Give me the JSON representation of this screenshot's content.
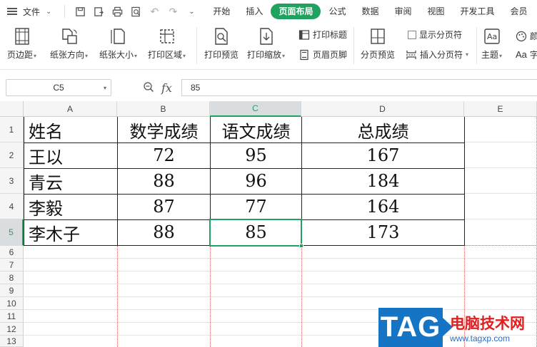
{
  "menubar": {
    "file_label": "文件",
    "tabs": [
      {
        "label": "开始",
        "active": false
      },
      {
        "label": "插入",
        "active": false
      },
      {
        "label": "页面布局",
        "active": true
      },
      {
        "label": "公式",
        "active": false
      },
      {
        "label": "数据",
        "active": false
      },
      {
        "label": "审阅",
        "active": false
      },
      {
        "label": "视图",
        "active": false
      },
      {
        "label": "开发工具",
        "active": false
      },
      {
        "label": "会员",
        "active": false
      }
    ]
  },
  "ribbon": {
    "margins": "页边距",
    "orientation": "纸张方向",
    "size": "纸张大小",
    "print_area": "打印区域",
    "print_preview": "打印预览",
    "print_scale": "打印缩放",
    "print_titles": "打印标题",
    "header_footer": "页眉页脚",
    "page_break_preview": "分页预览",
    "show_page_breaks": "显示分页符",
    "insert_page_break": "插入分页符",
    "theme": "主题",
    "font": "字",
    "color": "颜"
  },
  "formula_bar": {
    "name_box": "C5",
    "fx_label": "fx",
    "content": "85"
  },
  "grid": {
    "columns": [
      "A",
      "B",
      "C",
      "D",
      "E"
    ],
    "selected_column": "C",
    "rows": [
      "1",
      "2",
      "3",
      "4",
      "5",
      "6",
      "7",
      "8",
      "9",
      "10",
      "11",
      "12",
      "13"
    ],
    "selected_row": "5",
    "table": [
      [
        "姓名",
        "数学成绩",
        "语文成绩",
        "总成绩"
      ],
      [
        "王以",
        "72",
        "95",
        "167"
      ],
      [
        "青云",
        "88",
        "96",
        "184"
      ],
      [
        "李毅",
        "87",
        "77",
        "164"
      ],
      [
        "李木子",
        "88",
        "85",
        "173"
      ]
    ]
  },
  "watermark": {
    "logo": "TAG",
    "title": "电脑技术网",
    "url": "www.tagxp.com"
  },
  "colors": {
    "accent": "#1fa260",
    "page_break": "#d86b6b",
    "watermark_blue": "#1674c4",
    "watermark_red": "#e02020"
  }
}
